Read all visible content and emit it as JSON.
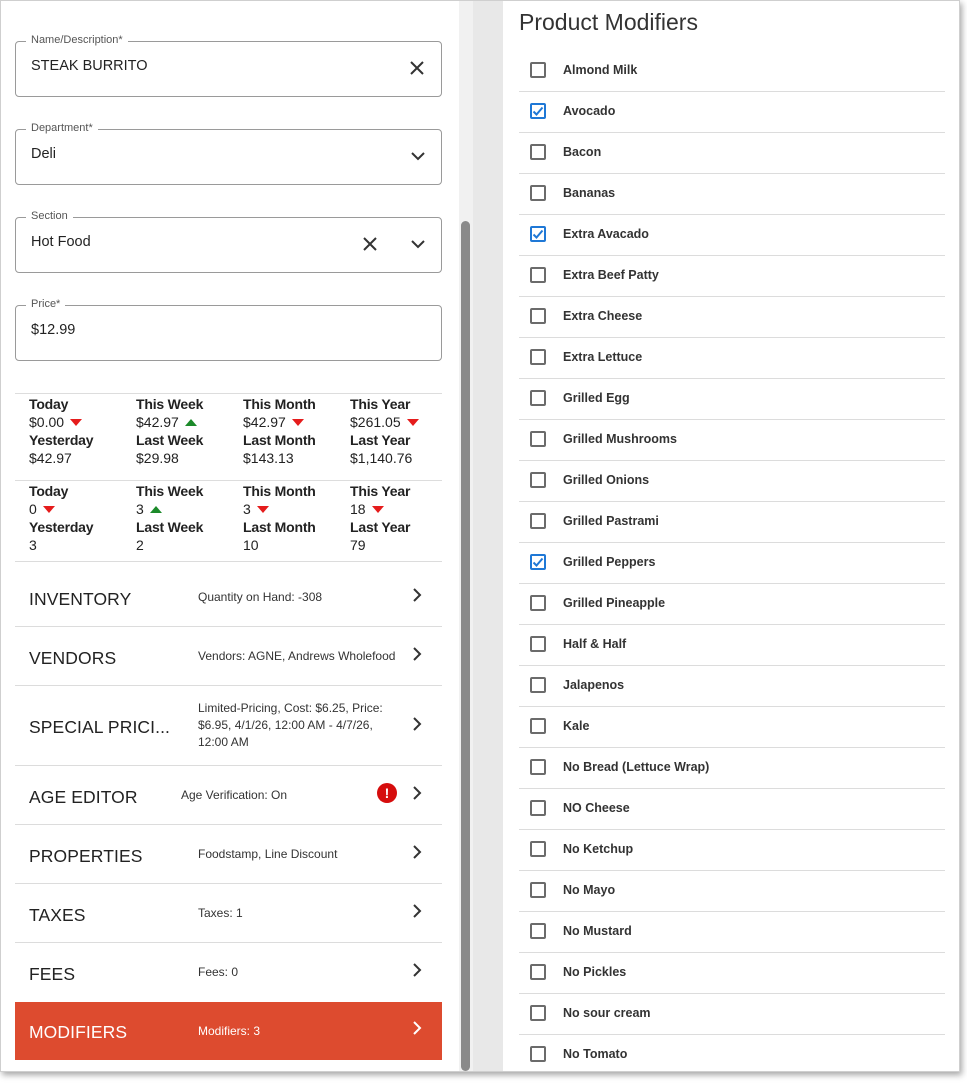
{
  "form": {
    "name": {
      "legend": "Name/Description*",
      "value": "STEAK BURRITO"
    },
    "department": {
      "legend": "Department*",
      "value": "Deli"
    },
    "section": {
      "legend": "Section",
      "value": "Hot Food"
    },
    "price": {
      "legend": "Price*",
      "value": "$12.99"
    }
  },
  "sales_stats": [
    {
      "label": "Today",
      "value": "$0.00",
      "trend": "down",
      "prev_label": "Yesterday",
      "prev_value": "$42.97"
    },
    {
      "label": "This Week",
      "value": "$42.97",
      "trend": "up",
      "prev_label": "Last Week",
      "prev_value": "$29.98"
    },
    {
      "label": "This Month",
      "value": "$42.97",
      "trend": "down",
      "prev_label": "Last Month",
      "prev_value": "$143.13"
    },
    {
      "label": "This Year",
      "value": "$261.05",
      "trend": "down",
      "prev_label": "Last Year",
      "prev_value": "$1,140.76"
    }
  ],
  "qty_stats": [
    {
      "label": "Today",
      "value": "0",
      "trend": "down",
      "prev_label": "Yesterday",
      "prev_value": "3"
    },
    {
      "label": "This Week",
      "value": "3",
      "trend": "up",
      "prev_label": "Last Week",
      "prev_value": "2"
    },
    {
      "label": "This Month",
      "value": "3",
      "trend": "down",
      "prev_label": "Last Month",
      "prev_value": "10"
    },
    {
      "label": "This Year",
      "value": "18",
      "trend": "down",
      "prev_label": "Last Year",
      "prev_value": "79"
    }
  ],
  "nav": [
    {
      "title": "INVENTORY",
      "desc": "Quantity on Hand: -308"
    },
    {
      "title": "VENDORS",
      "desc": "Vendors: AGNE, Andrews Wholefood"
    },
    {
      "title": "SPECIAL PRICI...",
      "desc": "Limited-Pricing, Cost: $6.25, Price: $6.95, 4/1/26, 12:00 AM - 4/7/26, 12:00 AM"
    },
    {
      "title": "AGE EDITOR",
      "desc": "Age Verification: On",
      "warning": "!"
    },
    {
      "title": "PROPERTIES",
      "desc": "Foodstamp, Line Discount"
    },
    {
      "title": "TAXES",
      "desc": "Taxes: 1"
    },
    {
      "title": "FEES",
      "desc": "Fees: 0"
    },
    {
      "title": "MODIFIERS",
      "desc": "Modifiers: 3",
      "active": true
    }
  ],
  "modifiers": {
    "title": "Product Modifiers",
    "items": [
      {
        "label": "Almond Milk",
        "checked": false
      },
      {
        "label": "Avocado",
        "checked": true
      },
      {
        "label": "Bacon",
        "checked": false
      },
      {
        "label": "Bananas",
        "checked": false
      },
      {
        "label": "Extra Avacado",
        "checked": true
      },
      {
        "label": "Extra Beef Patty",
        "checked": false
      },
      {
        "label": "Extra Cheese",
        "checked": false
      },
      {
        "label": "Extra Lettuce",
        "checked": false
      },
      {
        "label": "Grilled Egg",
        "checked": false
      },
      {
        "label": "Grilled Mushrooms",
        "checked": false
      },
      {
        "label": "Grilled Onions",
        "checked": false
      },
      {
        "label": "Grilled Pastrami",
        "checked": false
      },
      {
        "label": "Grilled Peppers",
        "checked": true
      },
      {
        "label": "Grilled Pineapple",
        "checked": false
      },
      {
        "label": "Half & Half",
        "checked": false
      },
      {
        "label": "Jalapenos",
        "checked": false
      },
      {
        "label": "Kale",
        "checked": false
      },
      {
        "label": "No Bread (Lettuce Wrap)",
        "checked": false
      },
      {
        "label": "NO Cheese",
        "checked": false
      },
      {
        "label": "No Ketchup",
        "checked": false
      },
      {
        "label": "No Mayo",
        "checked": false
      },
      {
        "label": "No Mustard",
        "checked": false
      },
      {
        "label": "No Pickles",
        "checked": false
      },
      {
        "label": "No sour cream",
        "checked": false
      },
      {
        "label": "No Tomato",
        "checked": false
      }
    ]
  },
  "colors": {
    "accent": "#dd4b2f",
    "checkbox": "#1f78d6",
    "trend_up": "#1c8a2a",
    "trend_down": "#e51c1c",
    "warning": "#d60d0d"
  }
}
